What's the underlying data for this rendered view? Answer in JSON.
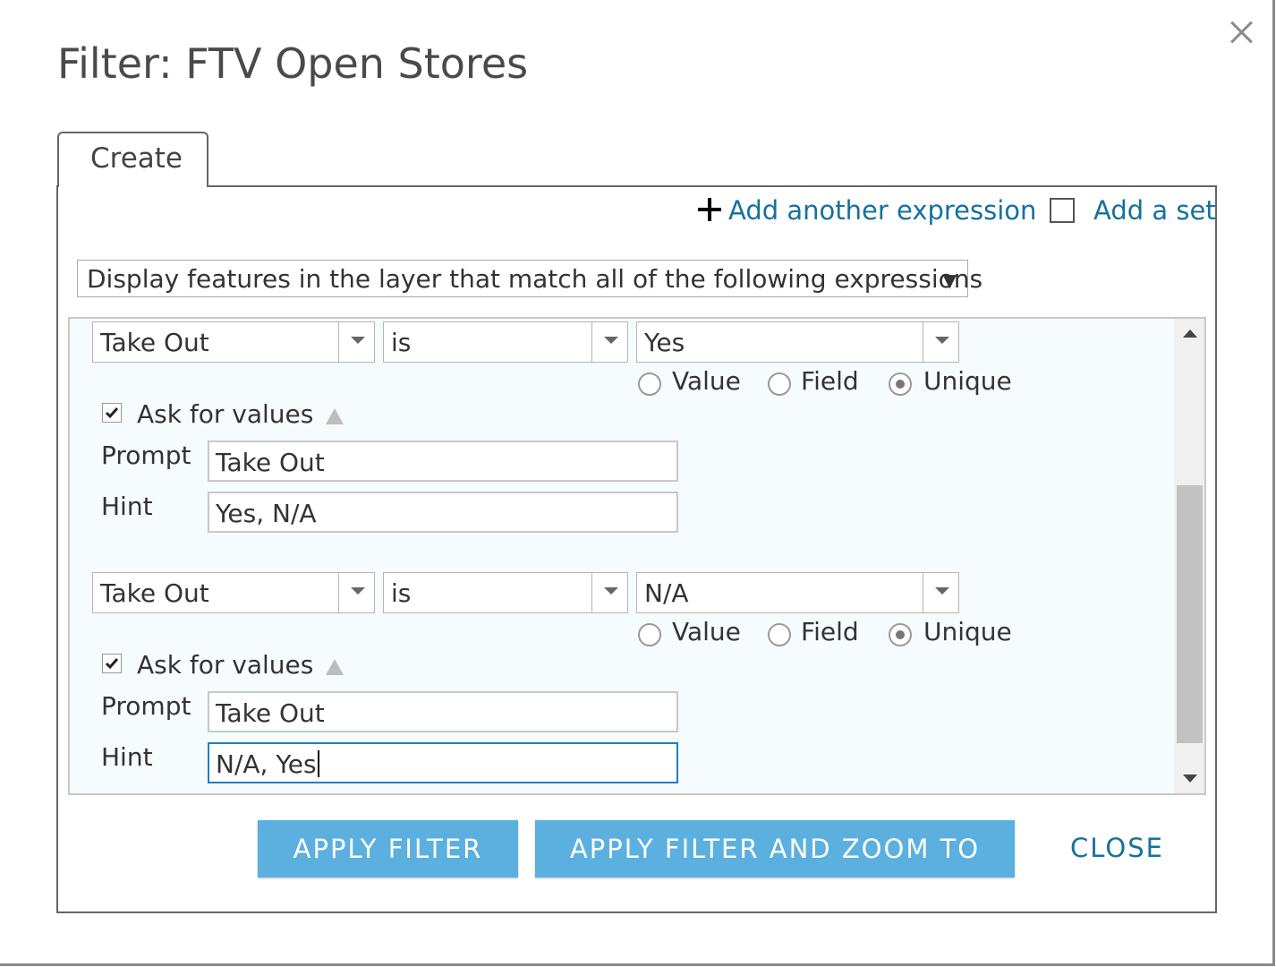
{
  "dialog": {
    "title": "Filter: FTV Open Stores"
  },
  "tabs": [
    {
      "label": "Create",
      "active": true
    }
  ],
  "toolbar": {
    "add_expression_label": "Add another expression",
    "add_set_label": "Add a set",
    "add_set_checked": false
  },
  "mode_select": {
    "selected": "Display features in the layer that match all of the following expressions"
  },
  "expressions": [
    {
      "field": "Take Out",
      "operator": "is",
      "value": "Yes",
      "value_types": [
        "Value",
        "Field",
        "Unique"
      ],
      "selected_type": "Unique",
      "ask_for_values": true,
      "ask_label": "Ask for values",
      "prompt_label": "Prompt",
      "prompt_value": "Take Out",
      "hint_label": "Hint",
      "hint_value": "Yes, N/A"
    },
    {
      "field": "Take Out",
      "operator": "is",
      "value": "N/A",
      "value_types": [
        "Value",
        "Field",
        "Unique"
      ],
      "selected_type": "Unique",
      "ask_for_values": true,
      "ask_label": "Ask for values",
      "prompt_label": "Prompt",
      "prompt_value": "Take Out",
      "hint_label": "Hint",
      "hint_value": "N/A, Yes"
    }
  ],
  "buttons": {
    "apply": "APPLY FILTER",
    "apply_zoom": "APPLY FILTER AND ZOOM TO",
    "close": "CLOSE"
  },
  "colors": {
    "link": "#15719e",
    "primary_button": "#5bb0df",
    "focus_border": "#1f7fc0",
    "expression_bg": "#f6fbfd"
  }
}
